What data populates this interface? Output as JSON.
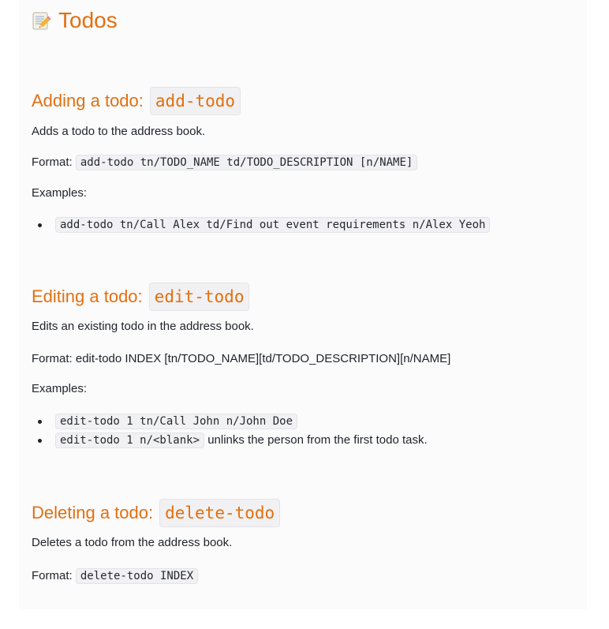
{
  "title": "Todos",
  "sections": [
    {
      "heading_text": "Adding a todo:",
      "heading_code": "add-todo",
      "description": "Adds a todo to the address book.",
      "format_label": "Format:",
      "format_code": "add-todo tn/TODO_NAME td/TODO_DESCRIPTION [n/NAME]",
      "examples_label": "Examples:",
      "examples": [
        {
          "code": "add-todo tn/Call Alex td/Find out event requirements n/Alex Yeoh",
          "text": ""
        }
      ]
    },
    {
      "heading_text": "Editing a todo:",
      "heading_code": "edit-todo",
      "description": "Edits an existing todo in the address book.",
      "format_label": "Format:",
      "format_text": "edit-todo INDEX [tn/TODO_NAME][td/TODO_DESCRIPTION][n/NAME]",
      "examples_label": "Examples:",
      "examples": [
        {
          "code": "edit-todo 1 tn/Call John n/John Doe",
          "text": ""
        },
        {
          "code": "edit-todo 1 n/<blank>",
          "text": "unlinks the person from the first todo task."
        }
      ]
    },
    {
      "heading_text": "Deleting a todo:",
      "heading_code": "delete-todo",
      "description": "Deletes a todo from the address book.",
      "format_label": "Format:",
      "format_code": "delete-todo INDEX"
    }
  ]
}
